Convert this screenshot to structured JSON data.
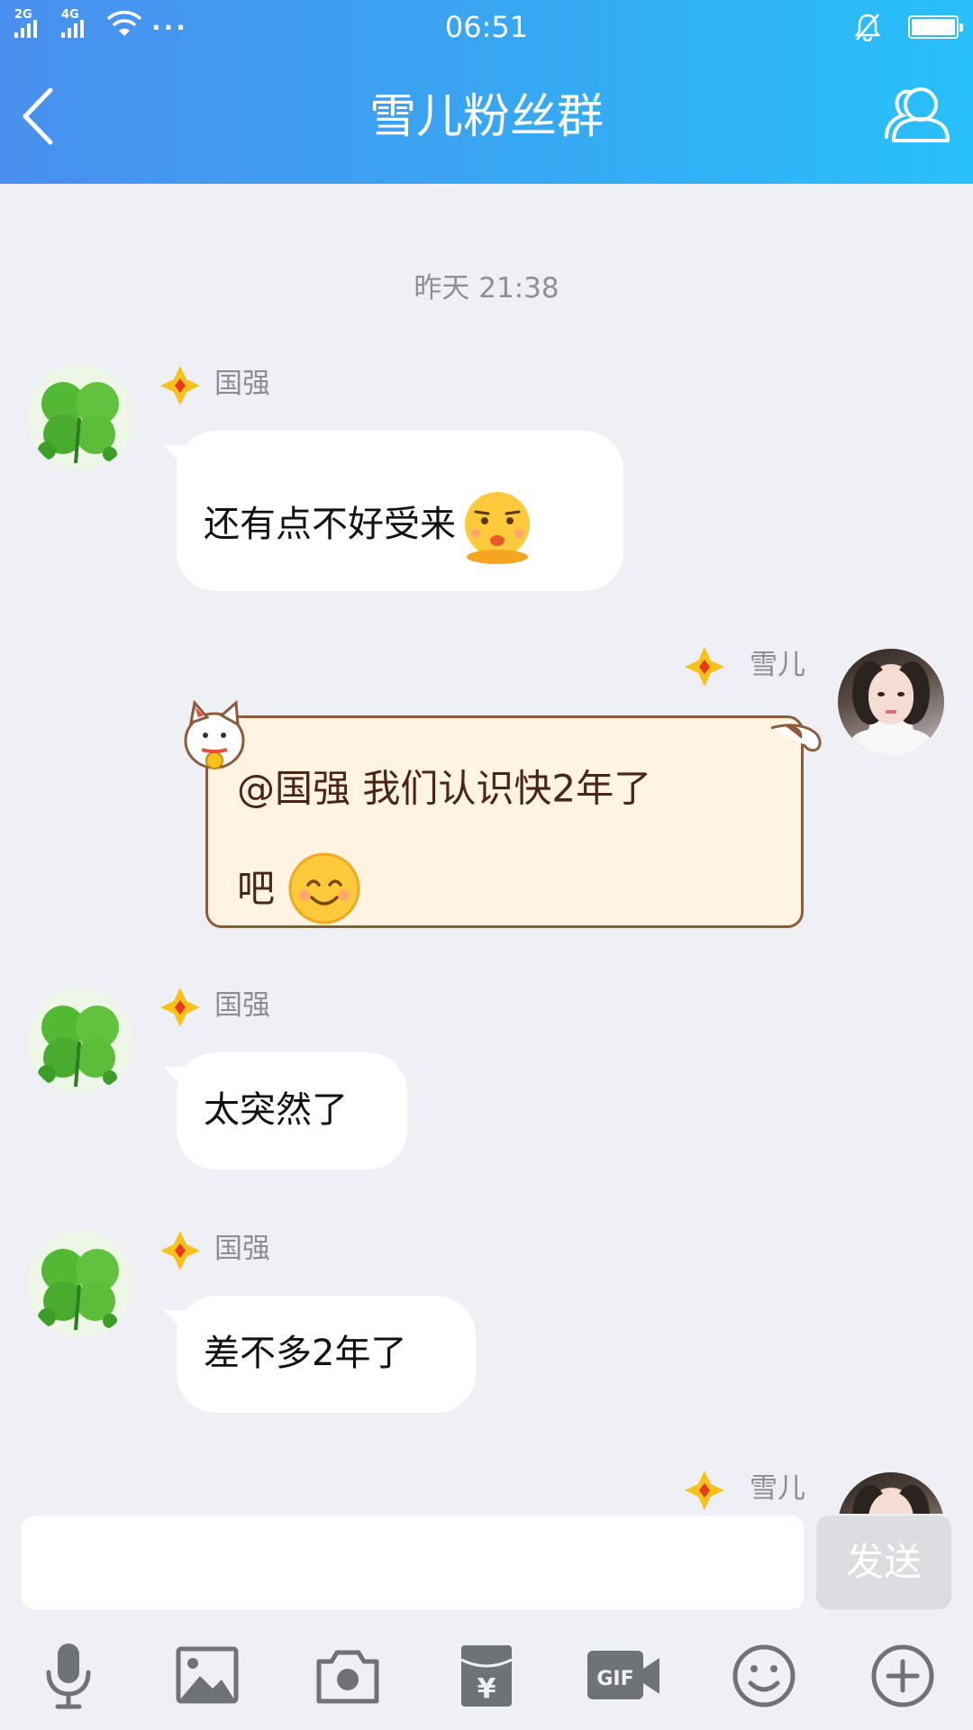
{
  "status_bar": {
    "signal1_label": "2G",
    "signal2_label": "4G",
    "more_indicator": "···",
    "time": "06:51",
    "icons": [
      "signal-icon",
      "wifi-icon",
      "mute-bell-icon",
      "battery-icon"
    ],
    "battery_level": 1.0
  },
  "header": {
    "back_icon": "chevron-left-icon",
    "title": "雪儿粉丝群",
    "group_icon": "group-members-icon"
  },
  "chat": {
    "timestamp": "昨天 21:38",
    "messages": [
      {
        "sender": "国强",
        "text": "还有点不好受来",
        "emoji": "sad-face-emoji",
        "side": "left"
      },
      {
        "sender": "雪儿",
        "line1": "@国强 我们认识快2年了",
        "line2": "吧",
        "emoji": "smile-emoji",
        "side": "right",
        "style": "cat-bubble"
      },
      {
        "sender": "国强",
        "text": "太突然了",
        "side": "left"
      },
      {
        "sender": "国强",
        "text": "差不多2年了",
        "side": "left"
      },
      {
        "sender": "雪儿",
        "side": "right"
      }
    ]
  },
  "input_bar": {
    "value": "",
    "placeholder": "",
    "send_label": "发送"
  },
  "toolbar": {
    "items": [
      "microphone-icon",
      "image-icon",
      "camera-icon",
      "red-packet-icon",
      "gif-icon",
      "emoji-icon",
      "plus-icon"
    ],
    "gif_label": "GIF",
    "yuan_label": "¥"
  },
  "colors": {
    "header_gradient_start": "#4a8fef",
    "header_gradient_end": "#28c0fb",
    "chat_background": "#eff0f5",
    "badge_gold": "#f7c21c",
    "send_disabled": "#dcdde1"
  }
}
